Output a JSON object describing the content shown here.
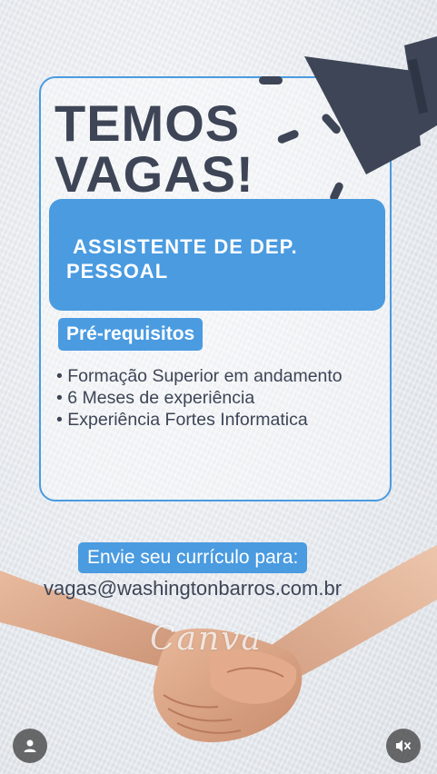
{
  "headline": {
    "line1": "TEMOS",
    "line2": "VAGAS!"
  },
  "job": {
    "title": " ASSISTENTE DE DEP.\nPESSOAL"
  },
  "requirements": {
    "heading": "Pré-requisitos",
    "items": [
      "Formação Superior em andamento",
      "6 Meses de experiência",
      "Experiência Fortes Informatica"
    ]
  },
  "cta": {
    "label": "Envie seu currículo para:",
    "email": "vagas@washingtonbarros.com.br"
  },
  "watermark": "Canva",
  "colors": {
    "accent": "#4a9be0",
    "text": "#3d4556",
    "background": "#e9edf2"
  },
  "icons": {
    "megaphone": "megaphone-icon",
    "user": "user-icon",
    "mute": "volume-mute-icon"
  }
}
